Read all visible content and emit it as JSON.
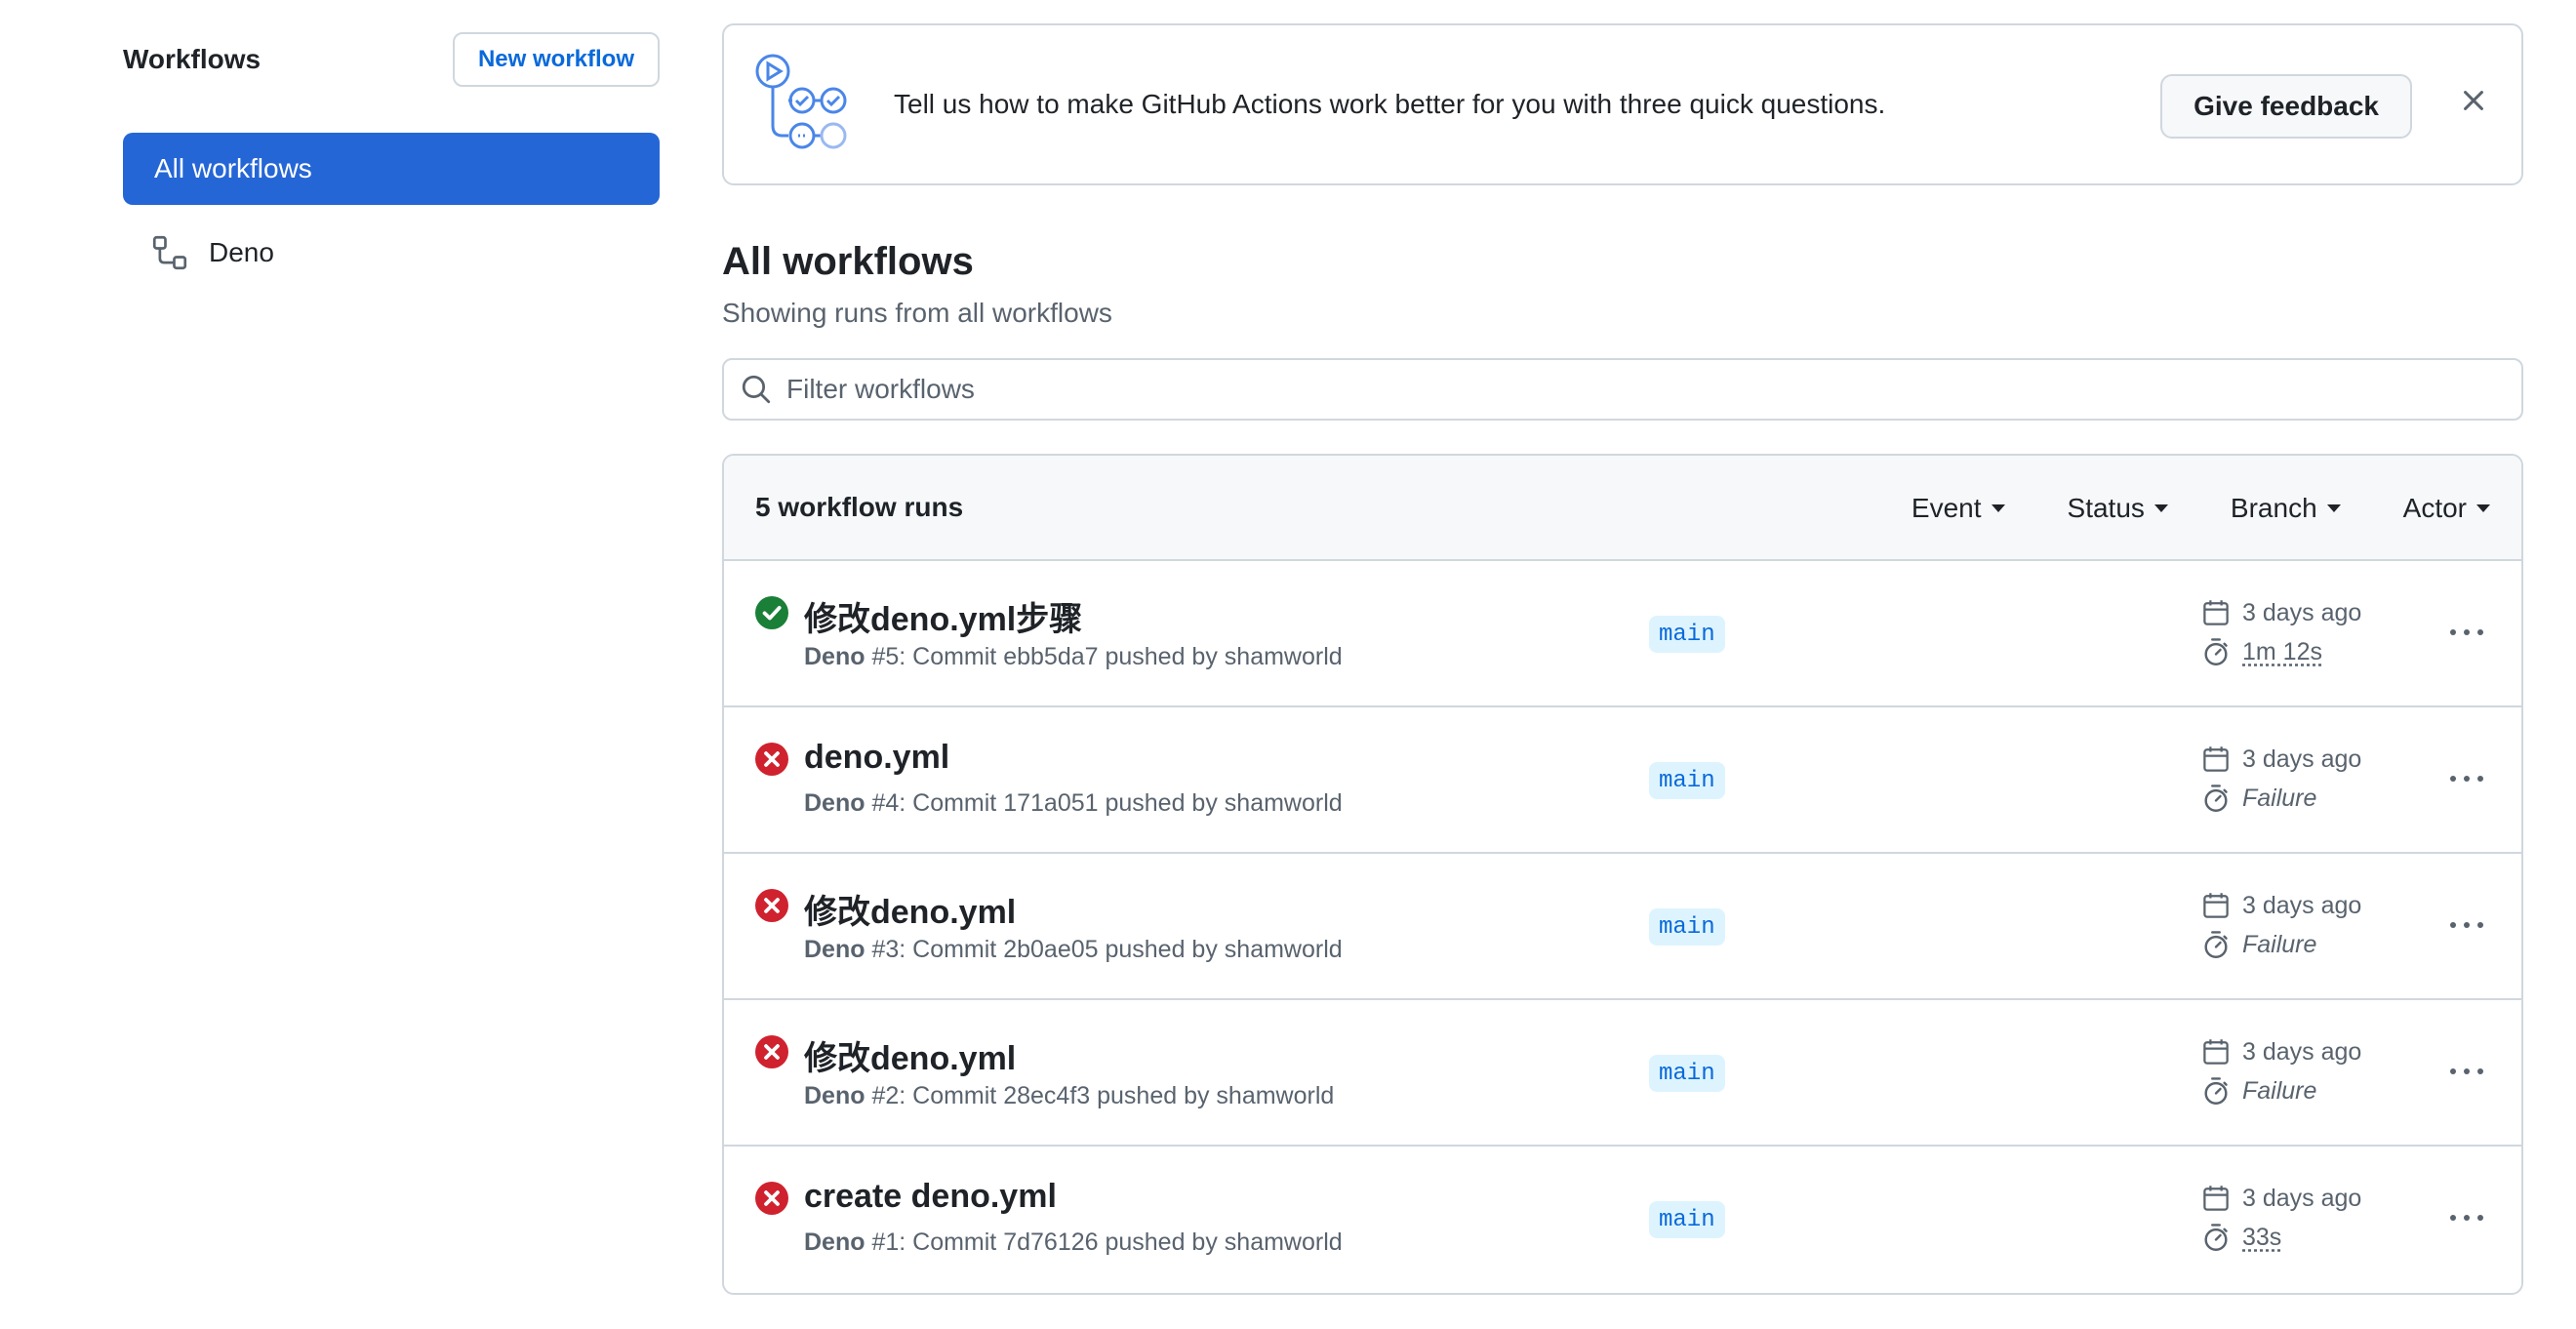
{
  "sidebar": {
    "title": "Workflows",
    "new_workflow_label": "New workflow",
    "items": [
      {
        "label": "All workflows",
        "active": true
      },
      {
        "label": "Deno",
        "active": false
      }
    ]
  },
  "banner": {
    "text": "Tell us how to make GitHub Actions work better for you with three quick questions.",
    "feedback_label": "Give feedback"
  },
  "main": {
    "title": "All workflows",
    "subtitle": "Showing runs from all workflows",
    "filter_placeholder": "Filter workflows"
  },
  "runs": {
    "count_label": "5 workflow runs",
    "filters": [
      "Event",
      "Status",
      "Branch",
      "Actor"
    ],
    "items": [
      {
        "status": "success",
        "title": "修改deno.yml步骤",
        "workflow": "Deno",
        "meta_rest": " #5: Commit ebb5da7 pushed by shamworld",
        "branch": "main",
        "when": "3 days ago",
        "duration": "1m 12s"
      },
      {
        "status": "failure",
        "title": "deno.yml",
        "workflow": "Deno",
        "meta_rest": " #4: Commit 171a051 pushed by shamworld",
        "branch": "main",
        "when": "3 days ago",
        "duration": "Failure"
      },
      {
        "status": "failure",
        "title": "修改deno.yml",
        "workflow": "Deno",
        "meta_rest": " #3: Commit 2b0ae05 pushed by shamworld",
        "branch": "main",
        "when": "3 days ago",
        "duration": "Failure"
      },
      {
        "status": "failure",
        "title": "修改deno.yml",
        "workflow": "Deno",
        "meta_rest": " #2: Commit 28ec4f3 pushed by shamworld",
        "branch": "main",
        "when": "3 days ago",
        "duration": "Failure"
      },
      {
        "status": "failure",
        "title": "create deno.yml",
        "workflow": "Deno",
        "meta_rest": " #1: Commit 7d76126 pushed by shamworld",
        "branch": "main",
        "when": "3 days ago",
        "duration": "33s"
      }
    ]
  },
  "icons": {
    "workflow": "workflow-icon",
    "actions_banner": "actions-illustration-icon",
    "close": "close-icon",
    "search": "search-icon",
    "success": "check-circle-fill-icon",
    "failure": "x-circle-fill-icon",
    "calendar": "calendar-icon",
    "stopwatch": "stopwatch-icon",
    "kebab": "kebab-horizontal-icon"
  },
  "colors": {
    "accent": "#2566d6",
    "link": "#0969da",
    "success": "#1a7f37",
    "failure": "#cf222e",
    "border": "#d0d7de",
    "muted": "#59636e"
  }
}
